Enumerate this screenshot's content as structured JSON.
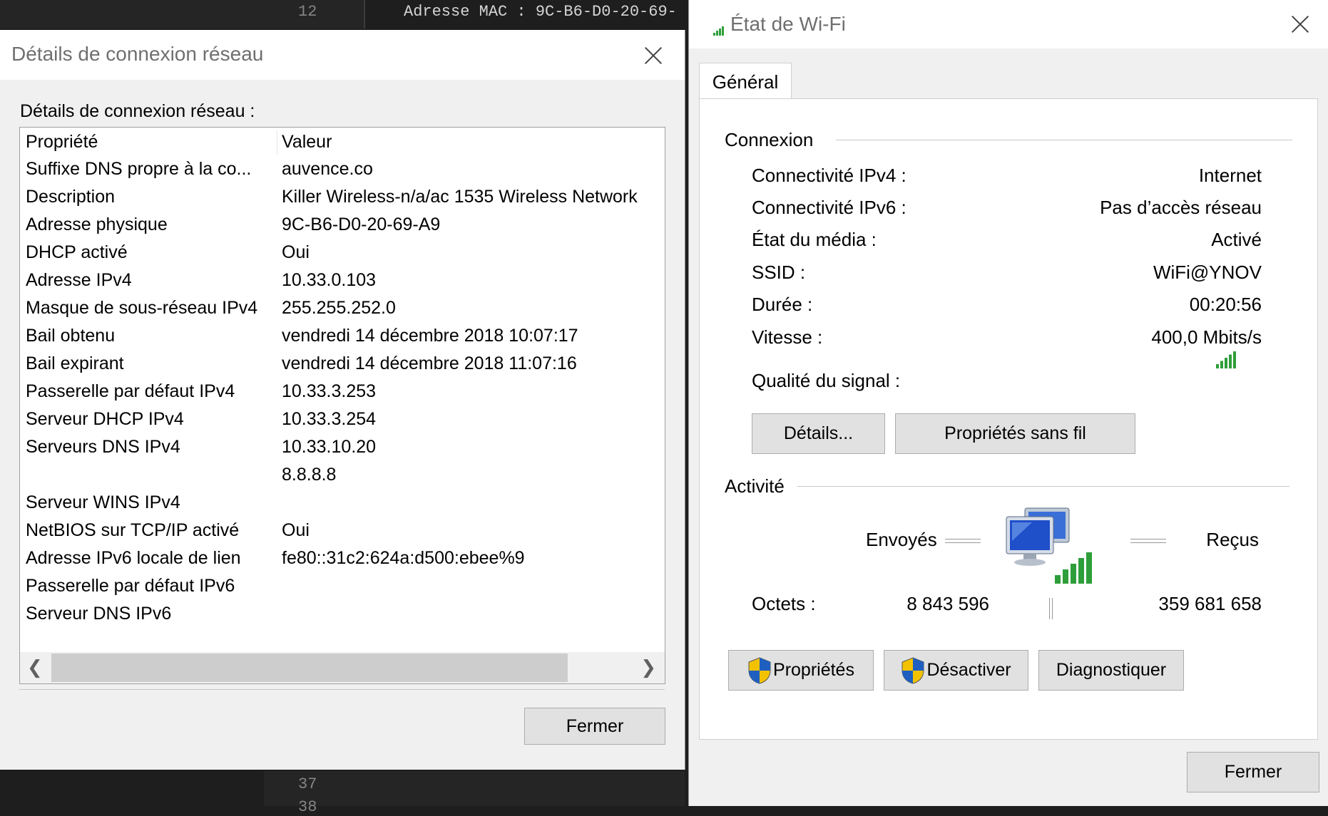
{
  "editor": {
    "top_line_number": "12",
    "top_line_text": "Adresse MAC : 9C-B6-D0-20-69-",
    "bottom_line_number": "37",
    "bottom_line_number_2": "38"
  },
  "details_dialog": {
    "title": "Détails de connexion réseau",
    "heading": "Détails de connexion réseau :",
    "columns": [
      "Propriété",
      "Valeur"
    ],
    "rows": [
      {
        "prop": "Suffixe DNS propre à la co...",
        "value": "auvence.co"
      },
      {
        "prop": "Description",
        "value": "Killer Wireless-n/a/ac 1535 Wireless Network"
      },
      {
        "prop": "Adresse physique",
        "value": "9C-B6-D0-20-69-A9"
      },
      {
        "prop": "DHCP activé",
        "value": "Oui"
      },
      {
        "prop": "Adresse IPv4",
        "value": "10.33.0.103"
      },
      {
        "prop": "Masque de sous-réseau IPv4",
        "value": "255.255.252.0"
      },
      {
        "prop": "Bail obtenu",
        "value": "vendredi 14 décembre 2018 10:07:17"
      },
      {
        "prop": "Bail expirant",
        "value": "vendredi 14 décembre 2018 11:07:16"
      },
      {
        "prop": "Passerelle par défaut IPv4",
        "value": "10.33.3.253"
      },
      {
        "prop": "Serveur DHCP IPv4",
        "value": "10.33.3.254"
      },
      {
        "prop": "Serveurs DNS IPv4",
        "value": "10.33.10.20"
      },
      {
        "prop": "",
        "value": "8.8.8.8"
      },
      {
        "prop": "Serveur WINS IPv4",
        "value": ""
      },
      {
        "prop": "NetBIOS sur TCP/IP activé",
        "value": "Oui"
      },
      {
        "prop": "Adresse IPv6 locale de lien",
        "value": "fe80::31c2:624a:d500:ebee%9"
      },
      {
        "prop": "Passerelle par défaut IPv6",
        "value": ""
      },
      {
        "prop": "Serveur DNS IPv6",
        "value": ""
      }
    ],
    "scroll_left": "❮",
    "scroll_right": "❯",
    "close_button": "Fermer"
  },
  "wifi_dialog": {
    "title": "État de Wi-Fi",
    "tab": "Général",
    "connexion_label": "Connexion",
    "connexion": [
      {
        "label": "Connectivité IPv4 :",
        "value": "Internet"
      },
      {
        "label": "Connectivité IPv6 :",
        "value": "Pas d’accès réseau"
      },
      {
        "label": "État du média :",
        "value": "Activé"
      },
      {
        "label": "SSID :",
        "value": "WiFi@YNOV"
      },
      {
        "label": "Durée :",
        "value": "00:20:56"
      },
      {
        "label": "Vitesse :",
        "value": "400,0 Mbits/s"
      }
    ],
    "signal_label": "Qualité du signal :",
    "signal_bars": 5,
    "details_button": "Détails...",
    "wireless_props_button": "Propriétés sans fil",
    "activity_label": "Activité",
    "sent_label": "Envoyés",
    "received_label": "Reçus",
    "bytes_label": "Octets :",
    "bytes_sent": "8 843 596",
    "bytes_received": "359 681 658",
    "properties_button": "Propriétés",
    "disable_button": "Désactiver",
    "diagnose_button": "Diagnostiquer",
    "close_button": "Fermer",
    "colors": {
      "signal_green": "#2e9e3a",
      "shield_blue": "#1f5fbf",
      "shield_yellow": "#f2c200"
    }
  }
}
